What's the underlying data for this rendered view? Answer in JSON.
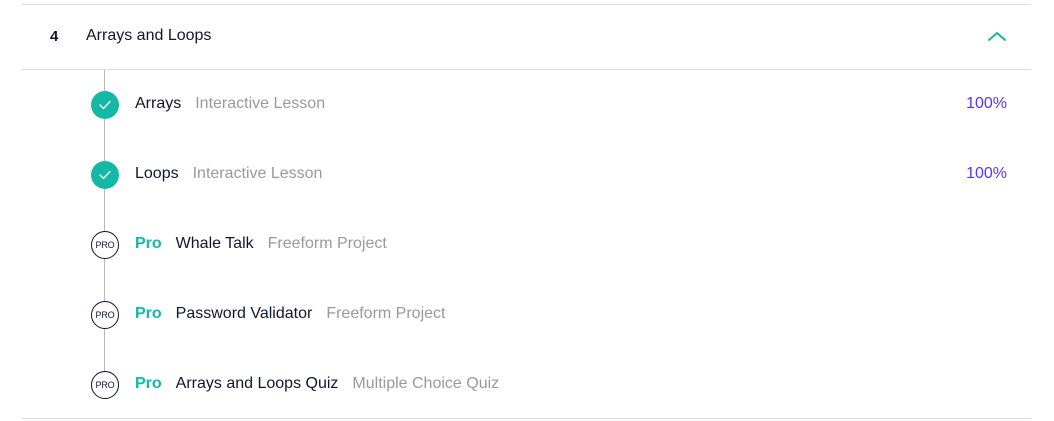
{
  "module": {
    "number": "4",
    "title": "Arrays and Loops",
    "expanded": true,
    "collapse_icon": "chevron-up-icon"
  },
  "colors": {
    "accent_teal": "#14b8a6",
    "progress_purple": "#5533ff",
    "text_dark": "#10162f",
    "text_muted": "#9a9a9a"
  },
  "lessons": [
    {
      "status": "completed",
      "status_icon": "check-circle-icon",
      "title": "Arrays",
      "type": "Interactive Lesson",
      "progress": "100%"
    },
    {
      "status": "completed",
      "status_icon": "check-circle-icon",
      "title": "Loops",
      "type": "Interactive Lesson",
      "progress": "100%"
    },
    {
      "status": "pro",
      "status_icon": "pro-badge-icon",
      "badge_text": "PRO",
      "pro_label": "Pro",
      "title": "Whale Talk",
      "type": "Freeform Project"
    },
    {
      "status": "pro",
      "status_icon": "pro-badge-icon",
      "badge_text": "PRO",
      "pro_label": "Pro",
      "title": "Password Validator",
      "type": "Freeform Project"
    },
    {
      "status": "pro",
      "status_icon": "pro-badge-icon",
      "badge_text": "PRO",
      "pro_label": "Pro",
      "title": "Arrays and Loops Quiz",
      "type": "Multiple Choice Quiz"
    }
  ]
}
